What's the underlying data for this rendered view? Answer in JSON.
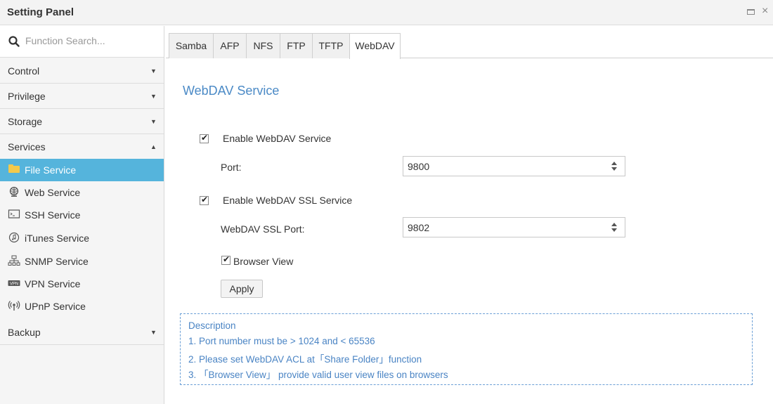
{
  "window": {
    "title": "Setting Panel",
    "maximize_icon": "maximize-icon",
    "close_icon": "close-icon",
    "close_glyph": "×"
  },
  "sidebar": {
    "search_placeholder": "Function Search...",
    "sections": [
      {
        "label": "Control",
        "state": "collapsed",
        "caret": "▼"
      },
      {
        "label": "Privilege",
        "state": "collapsed",
        "caret": "▼"
      },
      {
        "label": "Storage",
        "state": "collapsed",
        "caret": "▼"
      },
      {
        "label": "Services",
        "state": "expanded",
        "caret": "▲"
      },
      {
        "label": "Backup",
        "state": "collapsed",
        "caret": "▼"
      }
    ],
    "services": [
      {
        "label": "File Service",
        "icon": "file-service-icon",
        "active": true
      },
      {
        "label": "Web Service",
        "icon": "web-service-icon",
        "active": false
      },
      {
        "label": "SSH Service",
        "icon": "ssh-service-icon",
        "active": false
      },
      {
        "label": "iTunes Service",
        "icon": "itunes-service-icon",
        "active": false
      },
      {
        "label": "SNMP Service",
        "icon": "snmp-service-icon",
        "active": false
      },
      {
        "label": "VPN Service",
        "icon": "vpn-service-icon",
        "active": false
      },
      {
        "label": "UPnP Service",
        "icon": "upnp-service-icon",
        "active": false
      }
    ]
  },
  "tabs": [
    {
      "label": "Samba",
      "active": false
    },
    {
      "label": "AFP",
      "active": false
    },
    {
      "label": "NFS",
      "active": false
    },
    {
      "label": "FTP",
      "active": false
    },
    {
      "label": "TFTP",
      "active": false
    },
    {
      "label": "WebDAV",
      "active": true
    }
  ],
  "webdav": {
    "title": "WebDAV Service",
    "enable_label": "Enable WebDAV Service",
    "enable_checked": true,
    "port_label": "Port:",
    "port_value": "9800",
    "ssl_enable_label": "Enable WebDAV SSL Service",
    "ssl_enable_checked": true,
    "ssl_port_label": "WebDAV SSL Port:",
    "ssl_port_value": "9802",
    "browser_view_label": "Browser View",
    "browser_view_checked": true,
    "apply_label": "Apply"
  },
  "description": {
    "heading": "Description",
    "lines": [
      "1. Port number must be > 1024 and < 65536",
      "2. Please set WebDAV ACL at「Share Folder」function",
      "3. 「Browser View」 provide valid user view files on browsers"
    ]
  },
  "colors": {
    "accent": "#55b4dc",
    "title_blue": "#4b8ac6",
    "desc_blue": "#4a84c4"
  }
}
